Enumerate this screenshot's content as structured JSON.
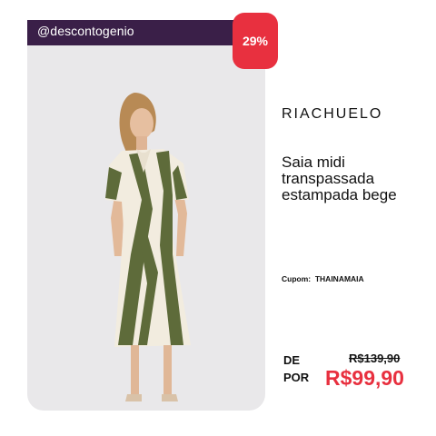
{
  "header": {
    "handle": "@descontogenio"
  },
  "badge": {
    "discount": "29%"
  },
  "product": {
    "brand": "RIACHUELO",
    "title": "Saia midi transpassada estampada bege",
    "coupon_label": "Cupom:",
    "coupon_code": "THAINAMAIA"
  },
  "price": {
    "from_label": "DE",
    "old": "R$139,90",
    "to_label": "POR",
    "new": "R$99,90"
  },
  "colors": {
    "accent": "#e8303f",
    "header": "#3a1f48",
    "dress_print": "#5e6b3a"
  }
}
